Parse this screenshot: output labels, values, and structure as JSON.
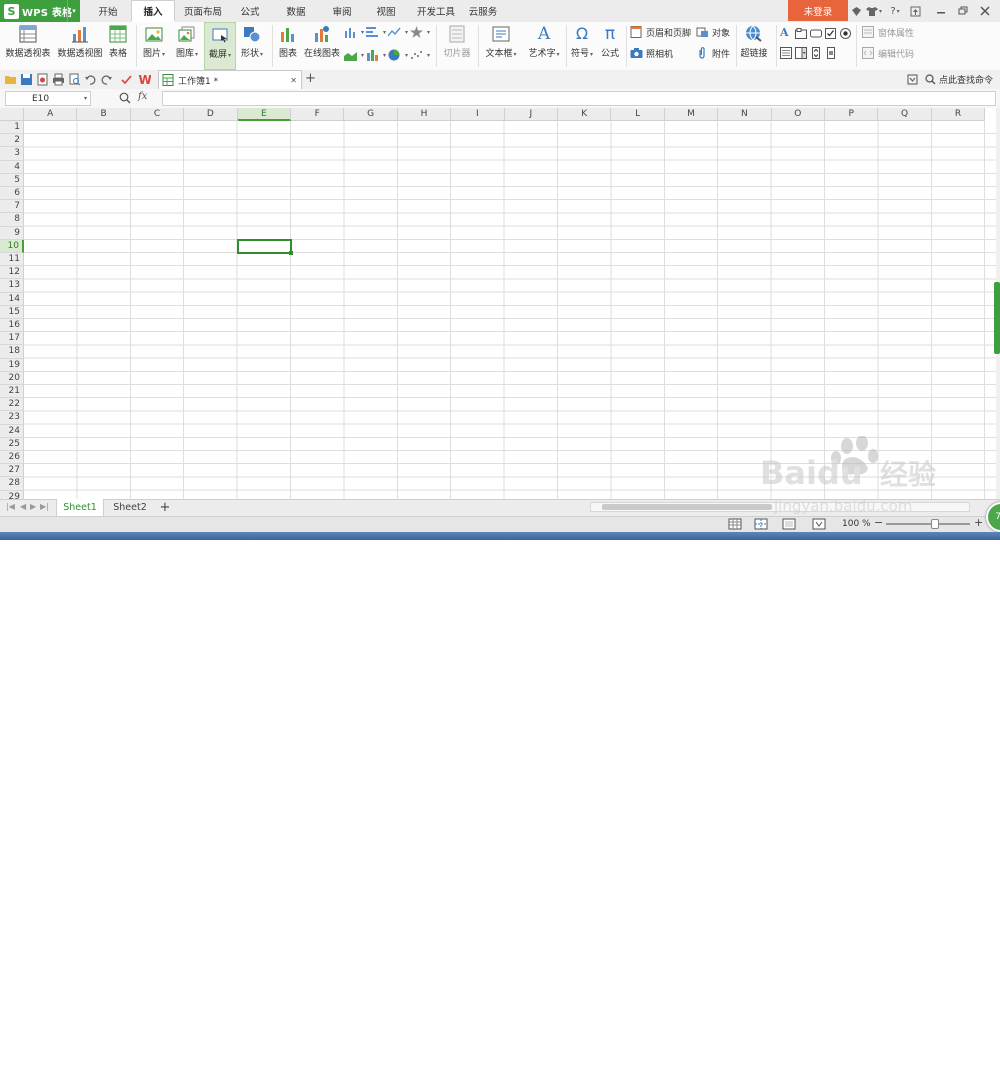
{
  "app": {
    "logo_letter": "S",
    "name": "WPS 表格",
    "logo_dropdown": "▾"
  },
  "tabs": [
    "开始",
    "插入",
    "页面布局",
    "公式",
    "数据",
    "审阅",
    "视图",
    "开发工具",
    "云服务"
  ],
  "active_tab": "插入",
  "login_label": "未登录",
  "title_icons": {
    "help": "?",
    "caret": "▾"
  },
  "ribbon": {
    "pivot_table": "数据透视表",
    "pivot_chart": "数据透视图",
    "table": "表格",
    "picture": "图片",
    "gallery": "图库",
    "screenshot": "截屏",
    "shapes": "形状",
    "chart": "图表",
    "online_chart": "在线图表",
    "slicer": "切片器",
    "textbox": "文本框",
    "wordart": "艺术字",
    "wordart_glyph": "A",
    "symbol": "符号",
    "symbol_glyph": "Ω",
    "formula": "公式",
    "formula_glyph": "π",
    "header_footer": "页眉和页脚",
    "object": "对象",
    "camera": "照相机",
    "attachment": "附件",
    "hyperlink": "超链接",
    "form_glyph": "A",
    "control_props": "窗体属性",
    "edit_code": "编辑代码"
  },
  "document_tab": {
    "title": "工作簿1 *",
    "close": "✕",
    "new_tab": "+"
  },
  "search_command": "点此查找命令",
  "name_box": "E10",
  "formula_fx": "fx",
  "columns": [
    "A",
    "B",
    "C",
    "D",
    "E",
    "F",
    "G",
    "H",
    "I",
    "J",
    "K",
    "L",
    "M",
    "N",
    "O",
    "P",
    "Q",
    "R"
  ],
  "rows": [
    "1",
    "2",
    "3",
    "4",
    "5",
    "6",
    "7",
    "8",
    "9",
    "10",
    "11",
    "12",
    "13",
    "14",
    "15",
    "16",
    "17",
    "18",
    "19",
    "20",
    "21",
    "22",
    "23",
    "24",
    "25",
    "26",
    "27",
    "28",
    "29"
  ],
  "active_cell": {
    "col": "E",
    "row": "10"
  },
  "sheets": [
    "Sheet1",
    "Sheet2"
  ],
  "active_sheet": "Sheet1",
  "add_sheet": "+",
  "nav_arrows": [
    "|◀",
    "◀",
    "▶",
    "▶|"
  ],
  "zoom": {
    "label": "100 %",
    "minus": "−",
    "plus": "+",
    "level_percent": 100
  },
  "help_badge": "73",
  "watermark": {
    "brand": "Baidu",
    "sub": "经验",
    "url": "jingyan.baidu.com"
  }
}
